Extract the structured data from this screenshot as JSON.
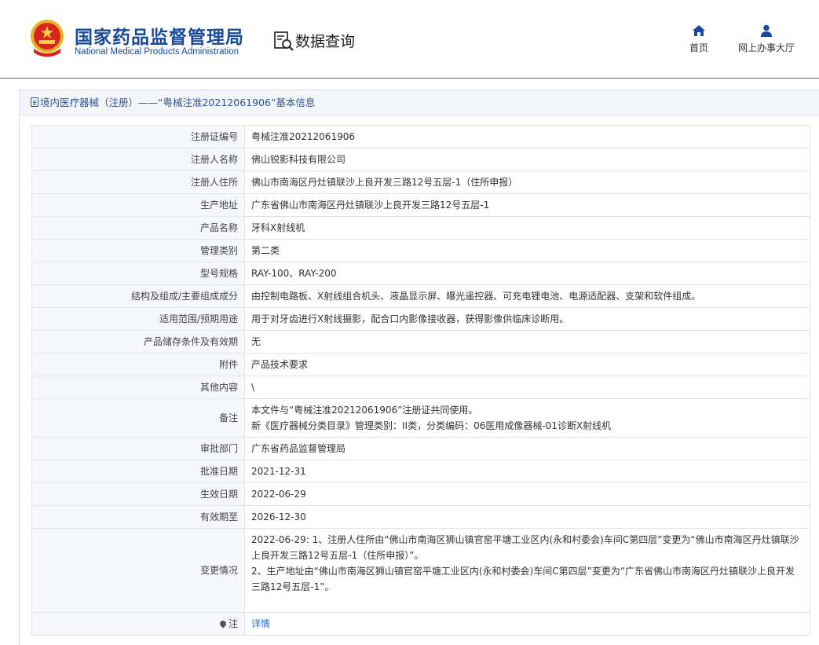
{
  "header": {
    "org_name_cn": "国家药品监督管理局",
    "org_name_en": "National Medical Products Administration",
    "search_title": "数据查询",
    "nav": {
      "home": "首页",
      "online_hall": "网上办事大厅"
    }
  },
  "breadcrumb": {
    "text": "境内医疗器械（注册）——“粤械注准20212061906”基本信息"
  },
  "colors": {
    "brand": "#1a4a9c",
    "link": "#2a6fc9",
    "label_bg": "#f5f7fa",
    "border": "#dfe3ea"
  },
  "icons": [
    "emblem-icon",
    "search-doc-icon",
    "home-icon",
    "user-icon",
    "doc-icon",
    "pin-icon"
  ],
  "rows": [
    {
      "label": "注册证编号",
      "value": "粤械注准20212061906"
    },
    {
      "label": "注册人名称",
      "value": "佛山锐影科技有限公司"
    },
    {
      "label": "注册人住所",
      "value": "佛山市南海区丹灶镇联沙上良开发三路12号五层-1（住所申报）"
    },
    {
      "label": "生产地址",
      "value": "广东省佛山市南海区丹灶镇联沙上良开发三路12号五层-1"
    },
    {
      "label": "产品名称",
      "value": "牙科X射线机"
    },
    {
      "label": "管理类别",
      "value": "第二类"
    },
    {
      "label": "型号规格",
      "value": "RAY-100、RAY-200"
    },
    {
      "label": "结构及组成/主要组成成分",
      "value": "由控制电路板、X射线组合机头、液晶显示屏、曝光遥控器、可充电锂电池、电源适配器、支架和软件组成。"
    },
    {
      "label": "适用范围/预期用途",
      "value": "用于对牙齿进行X射线摄影，配合口内影像接收器，获得影像供临床诊断用。"
    },
    {
      "label": "产品储存条件及有效期",
      "value": "无"
    },
    {
      "label": "附件",
      "value": "产品技术要求"
    },
    {
      "label": "其他内容",
      "value": "\\"
    }
  ],
  "note": {
    "label": "备注",
    "line1": "本文件与“粤械注准20212061906”注册证共同使用。",
    "line2": "新《医疗器械分类目录》管理类别：II类，分类编码：06医用成像器械-01诊断X射线机"
  },
  "rows2": [
    {
      "label": "审批部门",
      "value": "广东省药品监督管理局"
    },
    {
      "label": "批准日期",
      "value": "2021-12-31"
    },
    {
      "label": "生效日期",
      "value": "2022-06-29"
    },
    {
      "label": "有效期至",
      "value": "2026-12-30"
    }
  ],
  "change": {
    "label": "变更情况",
    "line1": "2022-06-29: 1、注册人住所由“佛山市南海区狮山镇官窑平塘工业区内(永和村委会)车间C第四层”变更为“佛山市南海区丹灶镇联沙上良开发三路12号五层-1（住所申报）”。",
    "line2": "2、生产地址由“佛山市南海区狮山镇官窑平塘工业区内(永和村委会)车间C第四层”变更为“广东省佛山市南海区丹灶镇联沙上良开发三路12号五层-1”。"
  },
  "footnote": {
    "label": "注",
    "link_text": "详情"
  }
}
